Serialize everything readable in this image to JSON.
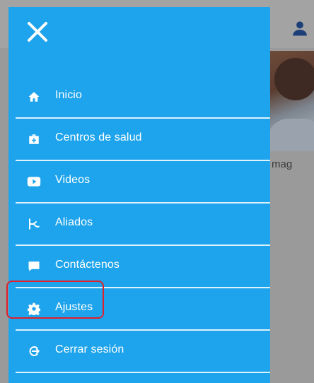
{
  "background": {
    "partial_caption": "mag"
  },
  "drawer": {
    "close_icon": "close-icon",
    "items": [
      {
        "label": "Inicio",
        "icon": "home-icon"
      },
      {
        "label": "Centros de salud",
        "icon": "medical-kit-icon"
      },
      {
        "label": "Videos",
        "icon": "video-play-icon"
      },
      {
        "label": "Aliados",
        "icon": "handshake-icon"
      },
      {
        "label": "Contáctenos",
        "icon": "chat-icon"
      },
      {
        "label": "Ajustes",
        "icon": "gear-icon"
      },
      {
        "label": "Cerrar sesión",
        "icon": "logout-icon"
      }
    ],
    "highlighted_item": "Ajustes"
  },
  "colors": {
    "drawer_bg": "#1ea4ec",
    "highlight": "#e0202a",
    "text": "#ffffff"
  }
}
